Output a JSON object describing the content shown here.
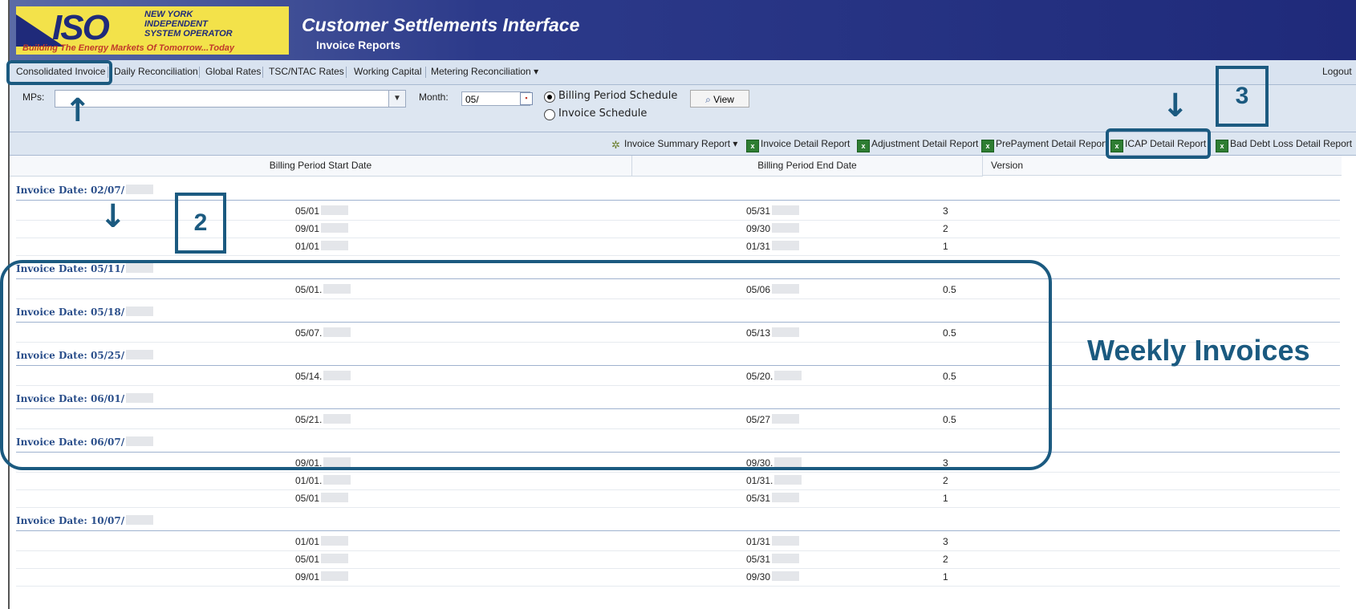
{
  "header": {
    "logo_iso": "ISO",
    "logo_line1": "NEW YORK",
    "logo_line2": "INDEPENDENT",
    "logo_line3": "SYSTEM OPERATOR",
    "logo_tagline": "Building The Energy Markets Of Tomorrow...Today",
    "title": "Customer Settlements Interface",
    "subtitle": "Invoice Reports"
  },
  "menu": {
    "items": [
      "Consolidated Invoice",
      "Daily Reconciliation",
      "Global Rates",
      "TSC/NTAC Rates",
      "Working Capital",
      "Metering Reconciliation"
    ],
    "logout": "Logout"
  },
  "filter": {
    "mps_label": "MPs:",
    "month_label": "Month:",
    "month_value": "05/",
    "radio_billing": "Billing Period Schedule",
    "radio_invoice": "Invoice Schedule",
    "view_label": "View"
  },
  "toolbar": {
    "summary": "Invoice Summary Report",
    "detail": "Invoice Detail Report",
    "adjustment": "Adjustment Detail Report",
    "prepayment": "PrePayment Detail Report",
    "icap": "ICAP Detail Report",
    "baddebt": "Bad Debt Loss Detail Report"
  },
  "grid": {
    "columns": [
      "Billing Period Start Date",
      "Billing Period End Date",
      "Version"
    ],
    "groups": [
      {
        "invoice": "Invoice Date: 02/07/",
        "rows": [
          [
            "05/01",
            "05/31",
            "3"
          ],
          [
            "09/01",
            "09/30",
            "2"
          ],
          [
            "01/01",
            "01/31",
            "1"
          ]
        ]
      },
      {
        "invoice": "Invoice Date: 05/11/",
        "rows": [
          [
            "05/01.",
            "05/06",
            "0.5"
          ]
        ]
      },
      {
        "invoice": "Invoice Date: 05/18/",
        "rows": [
          [
            "05/07.",
            "05/13",
            "0.5"
          ]
        ]
      },
      {
        "invoice": "Invoice Date: 05/25/",
        "rows": [
          [
            "05/14.",
            "05/20.",
            "0.5"
          ]
        ]
      },
      {
        "invoice": "Invoice Date: 06/01/",
        "rows": [
          [
            "05/21.",
            "05/27",
            "0.5"
          ]
        ]
      },
      {
        "invoice": "Invoice Date: 06/07/",
        "rows": [
          [
            "09/01.",
            "09/30.",
            "3"
          ],
          [
            "01/01.",
            "01/31.",
            "2"
          ],
          [
            "05/01",
            "05/31",
            "1"
          ]
        ]
      },
      {
        "invoice": "Invoice Date: 10/07/",
        "rows": [
          [
            "01/01",
            "01/31",
            "3"
          ],
          [
            "05/01",
            "05/31",
            "2"
          ],
          [
            "09/01",
            "09/30",
            "1"
          ]
        ]
      }
    ]
  },
  "annotations": {
    "num2": "2",
    "num3": "3",
    "weekly": "Weekly Invoices",
    "accent": "#1b5a80"
  }
}
